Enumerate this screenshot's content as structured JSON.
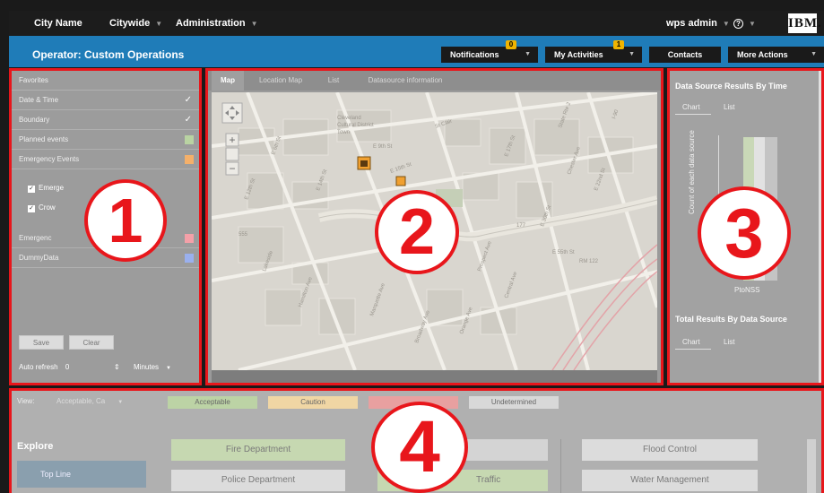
{
  "topbar": {
    "city": "City Name",
    "citywide": "Citywide",
    "administration": "Administration",
    "user": "wps admin",
    "help": "?",
    "logo": "IBM."
  },
  "header": {
    "title": "Operator: Custom Operations",
    "notifications": "Notifications",
    "notifications_badge": "0",
    "my_activities": "My Activities",
    "my_activities_badge": "1",
    "contacts": "Contacts",
    "more_actions": "More Actions"
  },
  "filters": {
    "favorites": "Favorites",
    "date_time": "Date & Time",
    "boundary": "Boundary",
    "planned_events": "Planned events",
    "emergency_events": "Emergency Events",
    "sub1": "Emerge",
    "sub2": "Crow",
    "emergency": "Emergenc",
    "dummy": "DummyData",
    "save": "Save",
    "clear": "Clear",
    "auto_refresh": "Auto refresh",
    "auto_refresh_value": "0",
    "minutes": "Minutes",
    "colors": {
      "planned": "#b9d3a2",
      "emergency": "#f4b06a",
      "emergency2": "#f4a0a8",
      "dummy": "#9ab0ee"
    }
  },
  "map": {
    "tabs": [
      "Map",
      "Location Map",
      "List",
      "Datasource information"
    ],
    "labels": [
      "Cleveland",
      "Cultural District",
      "Town",
      "E 9th St",
      "E 6th St",
      "E 12th St",
      "E 14th St",
      "E 15th St",
      "E 17th St",
      "Chester Ave",
      "Euclid Ave",
      "Carnegie Ave",
      "Prospect Ave",
      "Central Ave",
      "Orange Ave",
      "Broadway Ave",
      "E 30th St",
      "E 22nd St",
      "E 18th St",
      "E 55th St",
      "Lakeside",
      "Hamilton Ave",
      "Marquette Ave",
      "State Rte 2",
      "I-90",
      "177",
      "555",
      "RM 122",
      "St Clair"
    ]
  },
  "results": {
    "title": "Data Source Results By Time",
    "chart_tab": "Chart",
    "list_tab": "List",
    "y_axis": "Count of each data source",
    "x_label": "PtoNSS",
    "title2": "Total Results By Data Source",
    "chart_tab2": "Chart",
    "list_tab2": "List"
  },
  "explore": {
    "view_label": "View:",
    "view_value": "Acceptable, Ca",
    "statuses": [
      "Acceptable",
      "Caution",
      "",
      "Undetermined"
    ],
    "status_colors": [
      "#bcd3a5",
      "#f0d6a4",
      "#e8a0a0",
      "#d8d8d8"
    ],
    "explore_title": "Explore",
    "top_line": "Top Line",
    "services": [
      "Fire Department",
      "Police Department",
      "",
      "Traffic",
      "Flood Control",
      "Water Management"
    ]
  },
  "markers": [
    "1",
    "2",
    "3",
    "4"
  ]
}
